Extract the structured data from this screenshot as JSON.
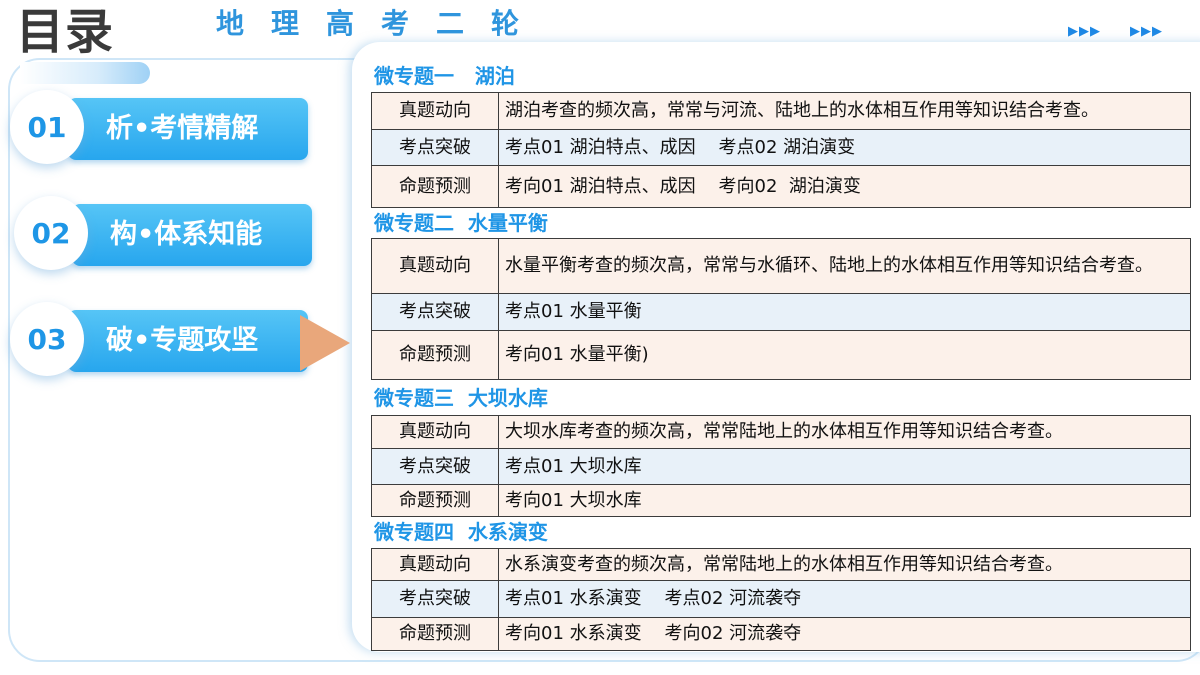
{
  "header": {
    "title": "目录",
    "subtitle": "地理高考二轮",
    "deco_left": "▶▶▶",
    "deco_right": "▶▶▶"
  },
  "colors": {
    "accent": "#1f95e6",
    "nav_bar": "#2ba7ef",
    "pointer": "#e9a77b",
    "row_peach": "#fcf1ea",
    "row_blue": "#e8f1f9"
  },
  "nav": [
    {
      "num": "01",
      "label": "析•考情精解"
    },
    {
      "num": "02",
      "label": "构•体系知能"
    },
    {
      "num": "03",
      "label": "破•专题攻坚"
    }
  ],
  "topics": [
    {
      "title": "微专题一   湖泊",
      "rows": [
        {
          "label": "真题动向",
          "value": "湖泊考查的频次高，常常与河流、陆地上的水体相互作用等知识结合考查。"
        },
        {
          "label": "考点突破",
          "value": "考点01 湖泊特点、成因    考点02 湖泊演变"
        },
        {
          "label": "命题预测",
          "value": "考向01 湖泊特点、成因    考向02  湖泊演变"
        }
      ]
    },
    {
      "title": "微专题二  水量平衡",
      "rows": [
        {
          "label": "真题动向",
          "value": "水量平衡考查的频次高，常常与水循环、陆地上的水体相互作用等知识结合考查。"
        },
        {
          "label": "考点突破",
          "value": "考点01 水量平衡"
        },
        {
          "label": "命题预测",
          "value": "考向01 水量平衡)"
        }
      ]
    },
    {
      "title": "微专题三  大坝水库",
      "rows": [
        {
          "label": "真题动向",
          "value": "大坝水库考查的频次高，常常陆地上的水体相互作用等知识结合考查。"
        },
        {
          "label": "考点突破",
          "value": "考点01 大坝水库"
        },
        {
          "label": "命题预测",
          "value": "考向01 大坝水库"
        }
      ]
    },
    {
      "title": "微专题四  水系演变",
      "rows": [
        {
          "label": "真题动向",
          "value": "水系演变考查的频次高，常常陆地上的水体相互作用等知识结合考查。"
        },
        {
          "label": "考点突破",
          "value": "考点01 水系演变    考点02 河流袭夺"
        },
        {
          "label": "命题预测",
          "value": "考向01 水系演变    考向02 河流袭夺"
        }
      ]
    }
  ]
}
